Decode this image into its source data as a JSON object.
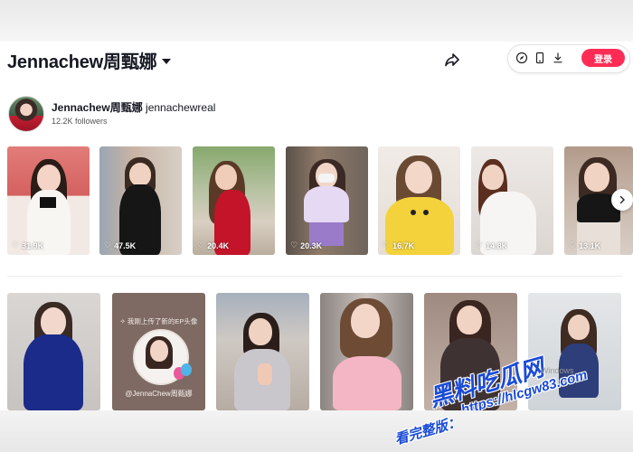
{
  "header": {
    "title": "Jennachew周甄娜",
    "login_label": "登录"
  },
  "profile": {
    "display_name": "Jennachew周甄娜",
    "username": "jennachewreal",
    "followers": "12.2K followers"
  },
  "row1": [
    {
      "likes": "31.9K"
    },
    {
      "likes": "47.5K"
    },
    {
      "likes": "20.4K"
    },
    {
      "likes": "20.3K"
    },
    {
      "likes": "16.7K"
    },
    {
      "likes": "14.8K"
    },
    {
      "likes": "13.1K"
    }
  ],
  "row2": {
    "card2_caption_top": "✧ 我刚上传了新的EP头像",
    "card2_caption_handle": "@JennaChew周甄娜"
  },
  "watermark": {
    "brand": "黑料吃瓜网",
    "url": "https://hlcgw83.com",
    "prefix": "看完整版：",
    "windows_text": "Windows"
  },
  "icons": {
    "share": "share-arrow-icon",
    "compass": "compass-icon",
    "mobile": "mobile-phone-icon",
    "download": "download-icon",
    "chevron": "chevron-right-icon",
    "heart": "heart-outline-icon"
  },
  "colors": {
    "accent": "#fe2c55",
    "text": "#161823",
    "watermark": "#1a4bd6"
  }
}
